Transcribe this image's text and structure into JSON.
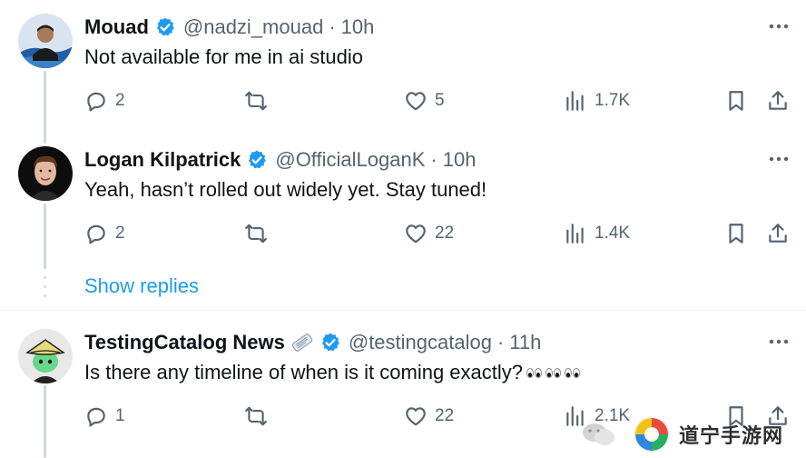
{
  "tweets": [
    {
      "name": "Mouad",
      "handle": "@nadzi_mouad",
      "sep": "·",
      "time": "10h",
      "text": "Not available for me in ai studio",
      "counts": {
        "replies": "2",
        "reposts": "",
        "likes": "5",
        "views": "1.7K"
      }
    },
    {
      "name": "Logan Kilpatrick",
      "handle": "@OfficialLoganK",
      "sep": "·",
      "time": "10h",
      "text": "Yeah, hasn’t rolled out widely yet. Stay tuned!",
      "counts": {
        "replies": "2",
        "reposts": "",
        "likes": "22",
        "views": "1.4K"
      }
    },
    {
      "name": "TestingCatalog News",
      "handle": "@testingcatalog",
      "sep": "·",
      "time": "11h",
      "text": "Is there any timeline of when is it coming exactly?",
      "counts": {
        "replies": "1",
        "reposts": "",
        "likes": "22",
        "views": "2.1K"
      }
    }
  ],
  "show_replies": "Show replies",
  "watermark": {
    "text": "道宁手游网"
  },
  "colors": {
    "accent": "#1d9bf0",
    "muted": "#536471",
    "text": "#0f1419",
    "thread": "#cfd9de"
  },
  "icons": [
    "verified-badge-icon",
    "more-icon",
    "reply-icon",
    "repost-icon",
    "like-icon",
    "views-icon",
    "bookmark-icon",
    "share-icon",
    "newspaper-icon",
    "eyes-emoji-icon"
  ]
}
